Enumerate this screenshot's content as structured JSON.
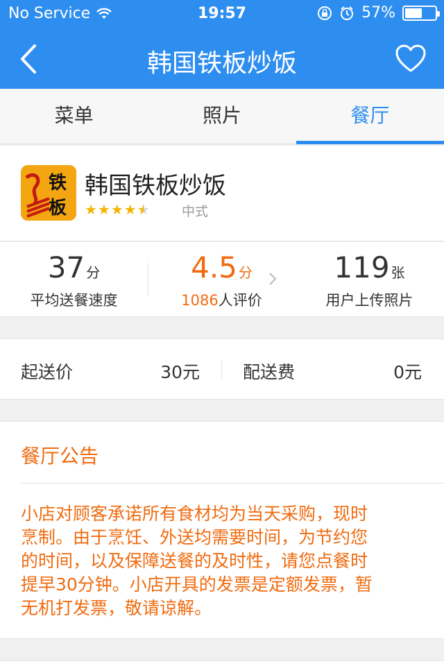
{
  "status_bar": {
    "carrier": "No Service",
    "time": "19:57",
    "battery_percent": "57%",
    "battery_level": 0.57,
    "icons": [
      "wifi-icon",
      "rotation-lock-icon",
      "alarm-icon",
      "battery-icon"
    ]
  },
  "nav": {
    "title": "韩国铁板炒饭",
    "icons": [
      "back-chevron-icon",
      "heart-icon"
    ]
  },
  "tabs": [
    {
      "label": "菜单",
      "active": false
    },
    {
      "label": "照片",
      "active": false
    },
    {
      "label": "餐厅",
      "active": true
    }
  ],
  "restaurant": {
    "name": "韩国铁板炒饭",
    "logo_text": "铁板",
    "rating_stars": 4.5,
    "cuisine": "中式"
  },
  "stats": {
    "delivery_speed": {
      "value": "37",
      "unit": "分",
      "label": "平均送餐速度"
    },
    "rating": {
      "value": "4.5",
      "unit": "分",
      "count": "1086",
      "count_suffix": "人评价"
    },
    "photos": {
      "value": "119",
      "unit": "张",
      "label": "用户上传照片"
    }
  },
  "delivery": {
    "min_label": "起送价",
    "min_value": "30元",
    "fee_label": "配送费",
    "fee_value": "0元"
  },
  "notice": {
    "title": "餐厅公告",
    "lines": [
      "小店对顾客承诺所有食材均为当天采购，现时",
      "烹制。由于烹饪、外送均需要时间，为节约您",
      "的时间，以及保障送餐的及时性，请您点餐时",
      "提早30分钟。小店开具的发票是定额发票，暂",
      "无机打发票，敬请谅解。"
    ]
  },
  "colors": {
    "primary_blue": "#2e8ef0",
    "accent_orange": "#f06b10",
    "star_yellow": "#f5b400"
  }
}
